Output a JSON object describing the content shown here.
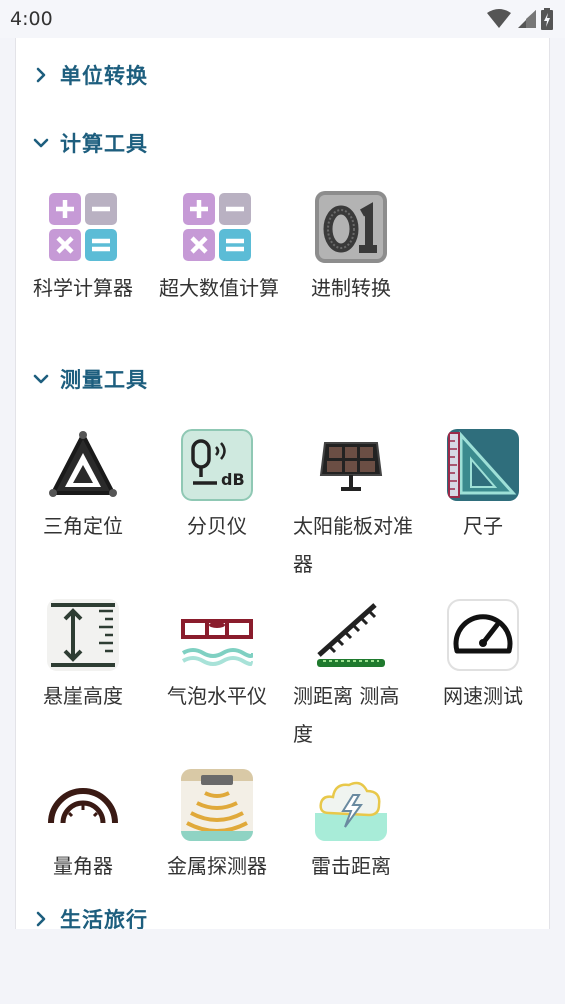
{
  "status_bar": {
    "time": "4:00",
    "icons": [
      "wifi-icon",
      "cell-signal-icon",
      "battery-charging-icon"
    ]
  },
  "sections": [
    {
      "title": "单位转换",
      "expanded": false
    },
    {
      "title": "计算工具",
      "expanded": true,
      "tools": [
        {
          "label": "科学计算器",
          "icon": "calculator-icon"
        },
        {
          "label": "超大数值计算",
          "icon": "calculator-icon"
        },
        {
          "label": "进制转换",
          "icon": "binary-icon"
        }
      ]
    },
    {
      "title": "测量工具",
      "expanded": true,
      "tools": [
        {
          "label": "三角定位",
          "icon": "triangle-icon"
        },
        {
          "label": "分贝仪",
          "icon": "decibel-meter-icon"
        },
        {
          "label": "太阳能板对准器",
          "icon": "solar-panel-icon"
        },
        {
          "label": "尺子",
          "icon": "ruler-icon"
        },
        {
          "label": "悬崖高度",
          "icon": "height-icon"
        },
        {
          "label": "气泡水平仪",
          "icon": "bubble-level-icon"
        },
        {
          "label": "测距离 测高度",
          "icon": "distance-icon"
        },
        {
          "label": "网速测试",
          "icon": "speedometer-icon"
        },
        {
          "label": "量角器",
          "icon": "protractor-icon"
        },
        {
          "label": "金属探测器",
          "icon": "metal-detector-icon"
        },
        {
          "label": "雷击距离",
          "icon": "lightning-cloud-icon"
        }
      ]
    },
    {
      "title": "生活旅行",
      "expanded": false
    }
  ],
  "colors": {
    "accent": "#1d5e7e",
    "background": "#f3f4f9",
    "card": "#ffffff"
  }
}
